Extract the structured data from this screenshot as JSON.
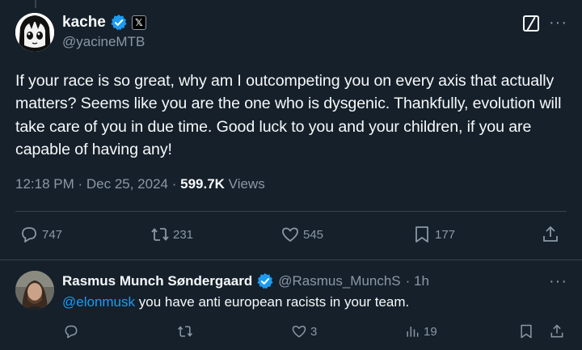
{
  "main_tweet": {
    "author_name": "kache",
    "author_handle": "@yacineMTB",
    "x_badge": "𝕏",
    "text": "If your race is so great, why am I outcompeting you on every axis that actually matters? Seems like you are the one who is dysgenic. Thankfully, evolution will take care of you in due time. Good luck to you and your children, if you are capable of having any!",
    "timestamp": "12:18 PM · Dec 25, 2024 · ",
    "views_count": "599.7K",
    "views_label": " Views",
    "stats": {
      "replies": "747",
      "reposts": "231",
      "likes": "545",
      "bookmarks": "177"
    },
    "more_label": "···"
  },
  "reply": {
    "author_name": "Rasmus Munch Søndergaard",
    "author_handle": "@Rasmus_MunchS",
    "time": "· 1h",
    "mention": "@elonmusk",
    "text": " you have anti european racists in your team.",
    "stats": {
      "likes": "3",
      "views": "19"
    },
    "more_label": "···"
  },
  "colors": {
    "background": "#15202b",
    "text_primary": "#f7f9f9",
    "text_secondary": "#8b98a5",
    "accent": "#1d9bf0",
    "divider": "#38444d"
  },
  "icons": [
    "verified-icon",
    "x-badge-icon",
    "grok-icon",
    "more-icon",
    "reply-icon",
    "repost-icon",
    "like-icon",
    "bookmark-icon",
    "share-icon",
    "views-icon"
  ]
}
